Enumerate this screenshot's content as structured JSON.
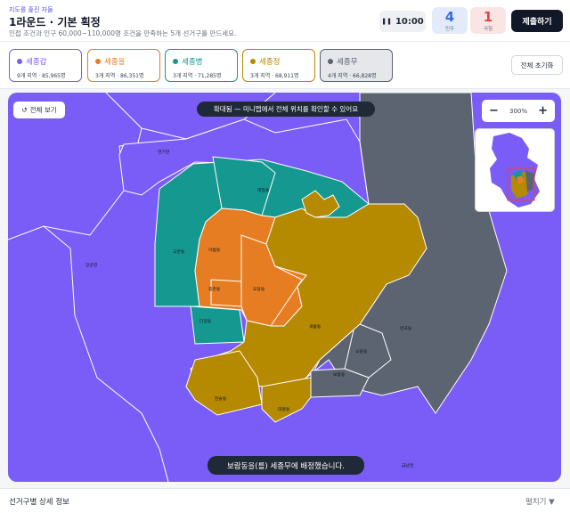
{
  "header": {
    "kicker": "지도를 훑진 자들",
    "title": "1라운드 · 기본 획정",
    "subtitle": "인접 조건과 인구 60,000~110,000명 조건을 만족하는 5개 선거구를 만드세요.",
    "timer": "10:00",
    "timer_icon": "pause-icon",
    "score_blue": {
      "value": "4",
      "label": "민주"
    },
    "score_red": {
      "value": "1",
      "label": "국힘"
    },
    "submit_label": "제출하기"
  },
  "districts": [
    {
      "name": "세종갑",
      "stats": "9개 지역 · 85,965명",
      "color": "#7b5cf5",
      "active": false
    },
    {
      "name": "세종을",
      "stats": "3개 지역 · 86,351명",
      "color": "#e77d22",
      "active": false
    },
    {
      "name": "세종병",
      "stats": "3개 지역 · 71,285명",
      "color": "#159890",
      "active": false
    },
    {
      "name": "세종정",
      "stats": "3개 지역 · 68,911명",
      "color": "#b58900",
      "active": false
    },
    {
      "name": "세종무",
      "stats": "4개 지역 · 66,828명",
      "color": "#5b6470",
      "active": true
    }
  ],
  "reset_all_label": "전체 초기화",
  "map": {
    "view_all_label": "전체 보기",
    "view_all_icon": "refresh-icon",
    "notice": "확대됨 — 미니맵에서 전체 위치를 확인할 수 있어요",
    "zoom": {
      "minus": "−",
      "level": "300%",
      "plus": "+"
    },
    "toast": "보람동을(를) 세종무에 배정했습니다.",
    "labels": {
      "yeonseo": "연기면",
      "haemil": "해밀동",
      "yeondong": "고운동",
      "areum": "아름동",
      "jongchon": "종촌동",
      "dodam": "도담동",
      "dajeong": "다정동",
      "saerom": "새롬동",
      "sodam": "소담동",
      "boram": "보람동",
      "hansol": "한솔동",
      "daepyeong": "대평동",
      "bangok": "반곡동",
      "janggun": "장군면",
      "geumnam": "금남면"
    }
  },
  "footer": {
    "title": "선거구별 상세 정보",
    "expand_label": "펼치기 ▼"
  }
}
